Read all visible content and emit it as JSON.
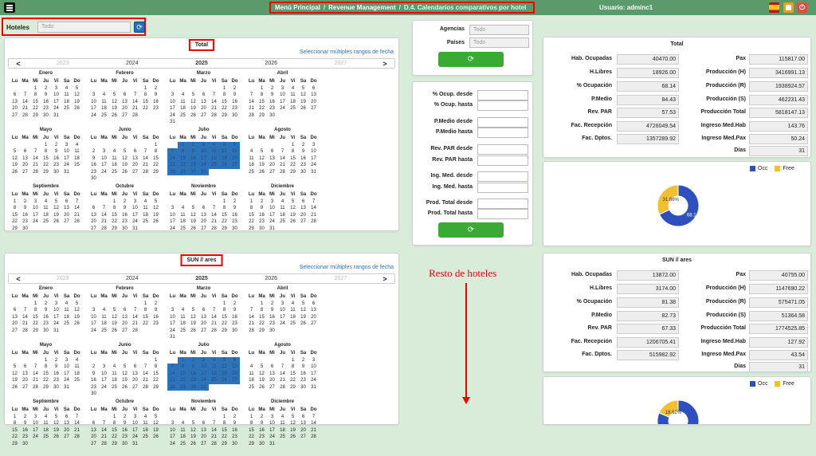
{
  "topbar": {
    "breadcrumb": [
      "Menú Principal",
      "Revenue Management",
      "D.4. Calendarios comparativos por hotel"
    ],
    "user": "Usuario: adminc1",
    "icons": [
      "menu-icon",
      "spain-flag-icon",
      "print-icon",
      "power-icon"
    ]
  },
  "hoteles": {
    "label": "Hoteles",
    "value": "Todo"
  },
  "cal": {
    "link": "Seleccionar múltiples rangos de fecha",
    "years": [
      "2023",
      "2024",
      "2025",
      "2026",
      "2027"
    ],
    "prev": "<",
    "next": ">",
    "days": [
      "Lu",
      "Ma",
      "Mi",
      "Ju",
      "Vi",
      "Sa",
      "Do"
    ],
    "months": [
      {
        "name": "Enero",
        "cells": [
          "",
          "",
          "1",
          "2",
          "3",
          "4",
          "5",
          "6",
          "7",
          "8",
          "9",
          "10",
          "11",
          "12",
          "13",
          "14",
          "15",
          "16",
          "17",
          "18",
          "19",
          "20",
          "21",
          "22",
          "23",
          "24",
          "25",
          "26",
          "27",
          "28",
          "29",
          "30",
          "31"
        ]
      },
      {
        "name": "Febrero",
        "cells": [
          "",
          "",
          "",
          "",
          "",
          "1",
          "2",
          "3",
          "4",
          "5",
          "6",
          "7",
          "8",
          "9",
          "10",
          "11",
          "12",
          "13",
          "14",
          "15",
          "16",
          "17",
          "18",
          "19",
          "20",
          "21",
          "22",
          "23",
          "24",
          "25",
          "26",
          "27",
          "28"
        ]
      },
      {
        "name": "Marzo",
        "cells": [
          "",
          "",
          "",
          "",
          "",
          "1",
          "2",
          "3",
          "4",
          "5",
          "6",
          "7",
          "8",
          "9",
          "10",
          "11",
          "12",
          "13",
          "14",
          "15",
          "16",
          "17",
          "18",
          "19",
          "20",
          "21",
          "22",
          "23",
          "24",
          "25",
          "26",
          "27",
          "28",
          "29",
          "30",
          "31"
        ]
      },
      {
        "name": "Abril",
        "cells": [
          "",
          "1",
          "2",
          "3",
          "4",
          "5",
          "6",
          "7",
          "8",
          "9",
          "10",
          "11",
          "12",
          "13",
          "14",
          "15",
          "16",
          "17",
          "18",
          "19",
          "20",
          "21",
          "22",
          "23",
          "24",
          "25",
          "26",
          "27",
          "28",
          "29",
          "30"
        ]
      },
      {
        "name": "Mayo",
        "cells": [
          "",
          "",
          "",
          "1",
          "2",
          "3",
          "4",
          "5",
          "6",
          "7",
          "8",
          "9",
          "10",
          "11",
          "12",
          "13",
          "14",
          "15",
          "16",
          "17",
          "18",
          "19",
          "20",
          "21",
          "22",
          "23",
          "24",
          "25",
          "26",
          "27",
          "28",
          "29",
          "30",
          "31"
        ]
      },
      {
        "name": "Junio",
        "cells": [
          "",
          "",
          "",
          "",
          "",
          "",
          "1",
          "2",
          "3",
          "4",
          "5",
          "6",
          "7",
          "8",
          "9",
          "10",
          "11",
          "12",
          "13",
          "14",
          "15",
          "16",
          "17",
          "18",
          "19",
          "20",
          "21",
          "22",
          "23",
          "24",
          "25",
          "26",
          "27",
          "28",
          "29",
          "30"
        ]
      },
      {
        "name": "Julio",
        "cells": [
          "",
          "1",
          "2",
          "3",
          "4",
          "5",
          "6",
          "7",
          "8",
          "9",
          "10",
          "11",
          "12",
          "13",
          "14",
          "15",
          "16",
          "17",
          "18",
          "19",
          "20",
          "21",
          "22",
          "23",
          "24",
          "25",
          "26",
          "27",
          "28",
          "29",
          "30",
          "31"
        ],
        "selected": true
      },
      {
        "name": "Agosto",
        "cells": [
          "",
          "",
          "",
          "",
          "1",
          "2",
          "3",
          "4",
          "5",
          "6",
          "7",
          "8",
          "9",
          "10",
          "11",
          "12",
          "13",
          "14",
          "15",
          "16",
          "17",
          "18",
          "19",
          "20",
          "21",
          "22",
          "23",
          "24",
          "25",
          "26",
          "27",
          "28",
          "29",
          "30",
          "31"
        ]
      },
      {
        "name": "Septiembre",
        "cells": [
          "1",
          "2",
          "3",
          "4",
          "5",
          "6",
          "7",
          "8",
          "9",
          "10",
          "11",
          "12",
          "13",
          "14",
          "15",
          "16",
          "17",
          "18",
          "19",
          "20",
          "21",
          "22",
          "23",
          "24",
          "25",
          "26",
          "27",
          "28",
          "29",
          "30"
        ]
      },
      {
        "name": "Octubre",
        "cells": [
          "",
          "",
          "1",
          "2",
          "3",
          "4",
          "5",
          "6",
          "7",
          "8",
          "9",
          "10",
          "11",
          "12",
          "13",
          "14",
          "15",
          "16",
          "17",
          "18",
          "19",
          "20",
          "21",
          "22",
          "23",
          "24",
          "25",
          "26",
          "27",
          "28",
          "29",
          "30",
          "31"
        ]
      },
      {
        "name": "Noviembre",
        "cells": [
          "",
          "",
          "",
          "",
          "",
          "1",
          "2",
          "3",
          "4",
          "5",
          "6",
          "7",
          "8",
          "9",
          "10",
          "11",
          "12",
          "13",
          "14",
          "15",
          "16",
          "17",
          "18",
          "19",
          "20",
          "21",
          "22",
          "23",
          "24",
          "25",
          "26",
          "27",
          "28",
          "29",
          "30"
        ]
      },
      {
        "name": "Diciembre",
        "cells": [
          "1",
          "2",
          "3",
          "4",
          "5",
          "6",
          "7",
          "8",
          "9",
          "10",
          "11",
          "12",
          "13",
          "14",
          "15",
          "16",
          "17",
          "18",
          "19",
          "20",
          "21",
          "22",
          "23",
          "24",
          "25",
          "26",
          "27",
          "28",
          "29",
          "30",
          "31"
        ]
      }
    ]
  },
  "cal1": {
    "title": "Total"
  },
  "cal2": {
    "title": "SUN // ares"
  },
  "selectors": {
    "agencias_label": "Agencias",
    "agencias_value": "Todo",
    "paises_label": "Países",
    "paises_value": "Todo"
  },
  "filters": {
    "labels": [
      "% Ocup. desde",
      "% Ocup. hasta",
      "P.Medio desde",
      "P.Medio hasta",
      "Rev. PAR desde",
      "Rev. PAR hasta",
      "Ing. Med. desde",
      "Ing. Med. hasta",
      "Prod. Total desde",
      "Prod. Total hasta"
    ]
  },
  "kpi_labels_left": [
    "Hab. Ocupadas",
    "H.Libres",
    "% Ocupación",
    "P.Medio",
    "Rev. PAR",
    "Fac. Recepción",
    "Fac. Dptos."
  ],
  "kpi_labels_right": [
    "Pax",
    "Producción (H)",
    "Producción (R)",
    "Producción (S)",
    "Producción Total",
    "Ingreso Med.Hab",
    "Ingreso Med.Pax",
    "Días"
  ],
  "kpi1": {
    "title": "Total",
    "left": [
      "40470.00",
      "18926.00",
      "68.14",
      "84.43",
      "57.53",
      "4726049.54",
      "1357289.92"
    ],
    "right": [
      "115817.00",
      "3416991.13",
      "1938924.57",
      "462231.43",
      "5818147.13",
      "143.76",
      "50.24",
      "31"
    ]
  },
  "kpi2": {
    "title": "SUN // ares",
    "left": [
      "13872.00",
      "3174.00",
      "81.38",
      "82.73",
      "67.33",
      "1206705.41",
      "515982.92"
    ],
    "right": [
      "40755.00",
      "1147690.22",
      "575471.05",
      "51364.58",
      "1774525.85",
      "127.92",
      "43.54",
      "31"
    ]
  },
  "legend": {
    "occ": "Occ",
    "free": "Free",
    "colors": {
      "occ": "#2e4fc0",
      "free": "#f2c02f"
    }
  },
  "chart_data": [
    {
      "type": "pie",
      "categories": [
        "Occ",
        "Free"
      ],
      "values": [
        68.14,
        31.86
      ],
      "labels": [
        "68.14%",
        "31.86%"
      ]
    },
    {
      "type": "pie",
      "categories": [
        "Occ",
        "Free"
      ],
      "values": [
        81.38,
        18.62
      ],
      "labels": [
        "81.38%",
        "18.62%"
      ]
    }
  ],
  "annotation": "Resto de hoteles"
}
